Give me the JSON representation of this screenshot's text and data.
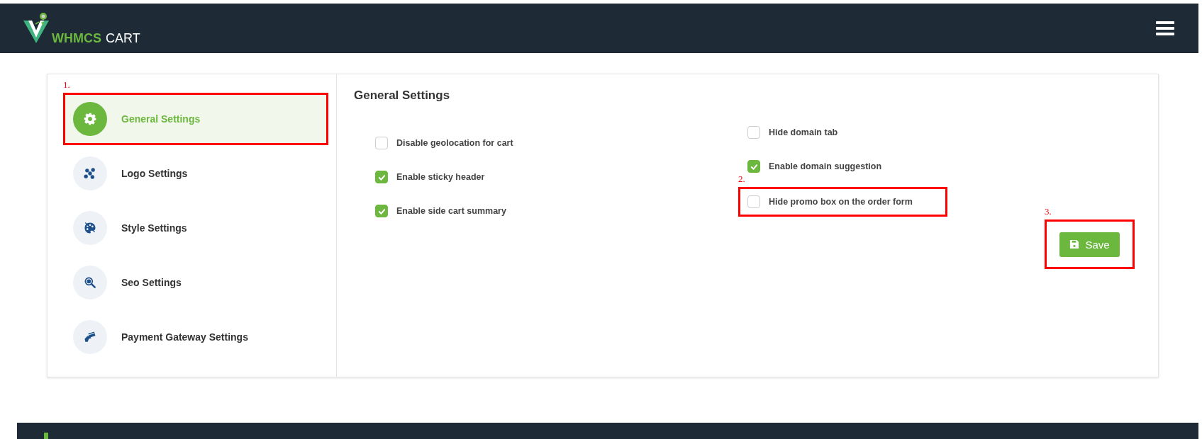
{
  "header": {
    "logo": {
      "brand": "WHMCS",
      "product": "CART"
    }
  },
  "sidebar": {
    "items": [
      {
        "label": "General Settings",
        "kind": "gear",
        "selected": true,
        "annotation": "1."
      },
      {
        "label": "Logo Settings",
        "kind": "molecule",
        "selected": false
      },
      {
        "label": "Style Settings",
        "kind": "palette",
        "selected": false
      },
      {
        "label": "Seo Settings",
        "kind": "magnifier",
        "selected": false
      },
      {
        "label": "Payment Gateway Settings",
        "kind": "card",
        "selected": false
      }
    ]
  },
  "panel": {
    "title": "General Settings",
    "columns": [
      {
        "options": [
          {
            "label": "Disable geolocation for cart",
            "checked": false
          },
          {
            "label": "Enable sticky header",
            "checked": true
          },
          {
            "label": "Enable side cart summary",
            "checked": true
          }
        ]
      },
      {
        "options": [
          {
            "label": "Hide domain tab",
            "checked": false
          },
          {
            "label": "Enable domain suggestion",
            "checked": true
          },
          {
            "label": "Hide promo box on the order form",
            "checked": false,
            "annotation": "2."
          }
        ]
      }
    ],
    "save_button": {
      "label": "Save",
      "annotation": "3."
    }
  }
}
